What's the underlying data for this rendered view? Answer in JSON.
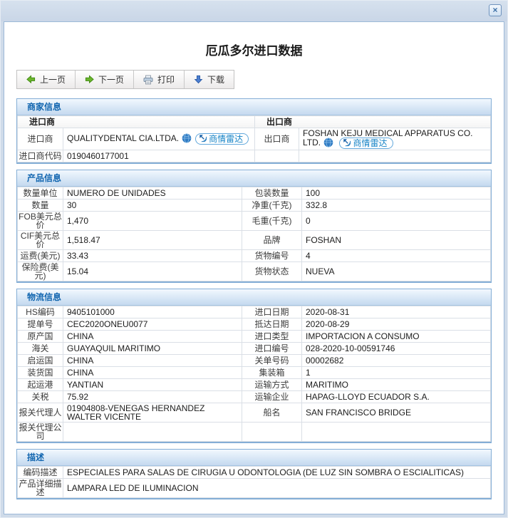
{
  "window": {
    "close_icon": "×"
  },
  "page": {
    "title": "厄瓜多尔进口数据"
  },
  "toolbar": {
    "prev_label": "上一页",
    "next_label": "下一页",
    "print_label": "打印",
    "download_label": "下载"
  },
  "sections": {
    "merchant": {
      "title": "商家信息",
      "importer_header": "进口商",
      "exporter_header": "出口商",
      "radar_badge_label": "商情雷达",
      "importer": {
        "label": "进口商",
        "value": "QUALITYDENTAL CIA.LTDA."
      },
      "exporter": {
        "label": "出口商",
        "value": "FOSHAN KEJU MEDICAL APPARATUS CO. LTD."
      },
      "importer_code": {
        "label": "进口商代码",
        "value": "0190460177001"
      }
    },
    "product": {
      "title": "产品信息",
      "rows": [
        {
          "l1": "数量单位",
          "v1": "NUMERO DE UNIDADES",
          "l2": "包装数量",
          "v2": "100"
        },
        {
          "l1": "数量",
          "v1": "30",
          "l2": "净重(千克)",
          "v2": "332.8"
        },
        {
          "l1": "FOB美元总价",
          "v1": "1,470",
          "l2": "毛重(千克)",
          "v2": "0"
        },
        {
          "l1": "CIF美元总价",
          "v1": "1,518.47",
          "l2": "品牌",
          "v2": "FOSHAN"
        },
        {
          "l1": "运费(美元)",
          "v1": "33.43",
          "l2": "货物编号",
          "v2": "4"
        },
        {
          "l1": "保险费(美元)",
          "v1": "15.04",
          "l2": "货物状态",
          "v2": "NUEVA"
        }
      ]
    },
    "logistics": {
      "title": "物流信息",
      "rows": [
        {
          "l1": "HS编码",
          "v1": "9405101000",
          "l2": "进口日期",
          "v2": "2020-08-31"
        },
        {
          "l1": "提单号",
          "v1": "CEC2020ONEU0077",
          "l2": "抵达日期",
          "v2": "2020-08-29"
        },
        {
          "l1": "原产国",
          "v1": "CHINA",
          "l2": "进口类型",
          "v2": "IMPORTACION A CONSUMO"
        },
        {
          "l1": "海关",
          "v1": "GUAYAQUIL MARITIMO",
          "l2": "进口编号",
          "v2": "028-2020-10-00591746"
        },
        {
          "l1": "启运国",
          "v1": "CHINA",
          "l2": "关单号码",
          "v2": "00002682"
        },
        {
          "l1": "装货国",
          "v1": "CHINA",
          "l2": "集装箱",
          "v2": "1"
        },
        {
          "l1": "起运港",
          "v1": "YANTIAN",
          "l2": "运输方式",
          "v2": "MARITIMO"
        },
        {
          "l1": "关税",
          "v1": "75.92",
          "l2": "运输企业",
          "v2": "HAPAG-LLOYD ECUADOR S.A."
        },
        {
          "l1": "报关代理人",
          "v1": "01904808-VENEGAS HERNANDEZ WALTER VICENTE",
          "l2": "船名",
          "v2": "SAN FRANCISCO BRIDGE"
        },
        {
          "l1": "报关代理公司",
          "v1": "",
          "l2": "",
          "v2": ""
        }
      ]
    },
    "description": {
      "title": "描述",
      "rows": [
        {
          "l": "编码描述",
          "v": "ESPECIALES PARA SALAS DE CIRUGIA U ODONTOLOGIA (DE LUZ SIN SOMBRA O ESCIALITICAS)"
        },
        {
          "l": "产品详细描述",
          "v": "LAMPARA LED DE ILUMINACION"
        }
      ]
    }
  },
  "colors": {
    "titlebar_bg": "#cfdbe9",
    "section_border": "#84aed6",
    "section_title_text": "#1266b0",
    "section_band_bg": "#cfe1f3",
    "cell_border": "#dadfe6",
    "badge_border": "#62a8dc",
    "badge_text": "#1583c6",
    "arrow_green": "#5fb02a",
    "arrow_blue": "#3d6fc4"
  }
}
